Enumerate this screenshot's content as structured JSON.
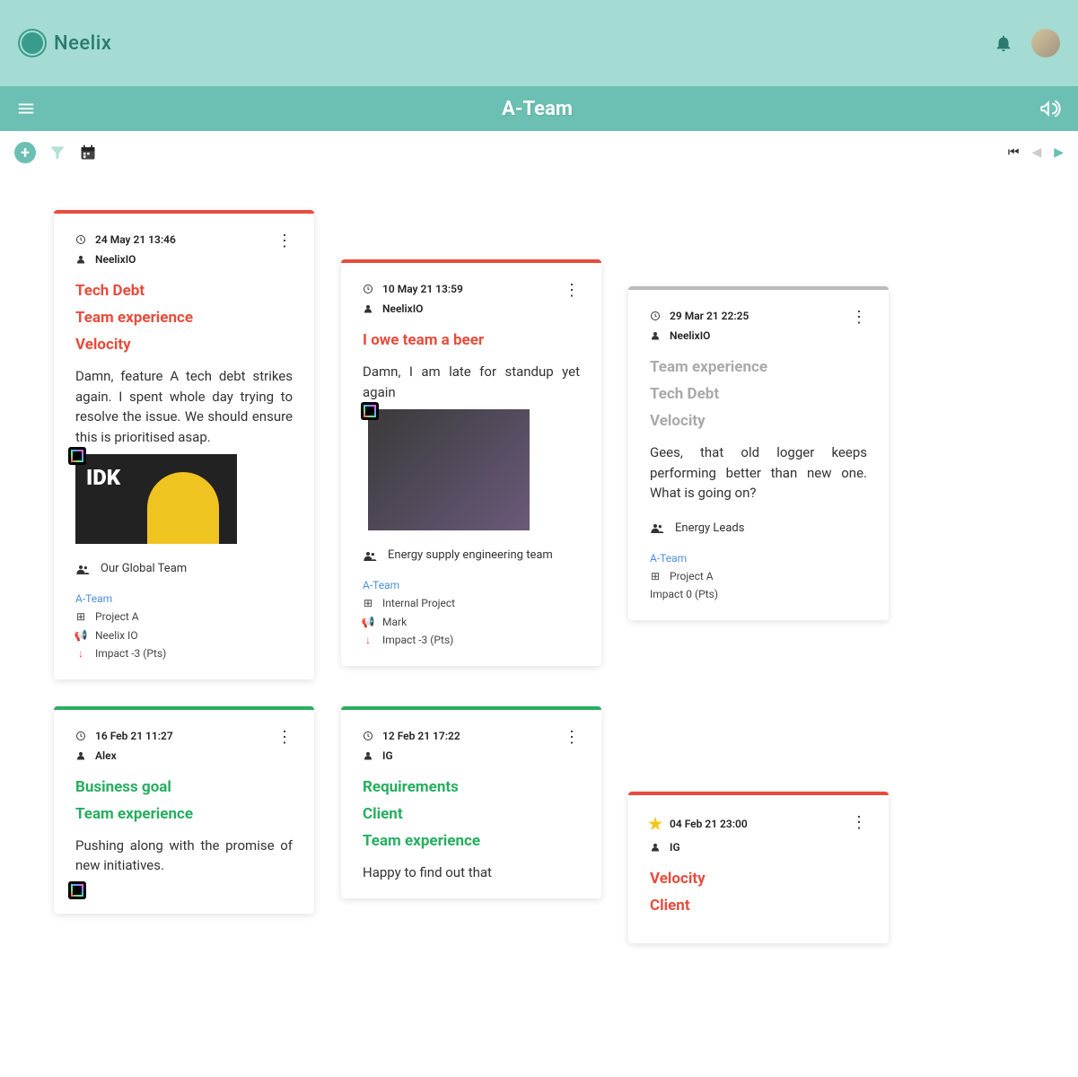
{
  "brand": "Neelix",
  "page_title": "A-Team",
  "cards": [
    {
      "timestamp": "24 May 21 13:46",
      "author": "NeelixIO",
      "tags": [
        "Tech Debt",
        "Team experience",
        "Velocity"
      ],
      "tag_color": "red",
      "border": "red",
      "body": "Damn, feature A tech debt strikes again. I spent whole day trying to resolve the issue. We should ensure this is prioritised asap.",
      "image_text": "IDK",
      "team": "Our Global Team",
      "footer_link": "A-Team",
      "project": "Project A",
      "speaker": "Neelix IO",
      "impact": "Impact  -3   (Pts)"
    },
    {
      "timestamp": "10 May 21 13:59",
      "author": "NeelixIO",
      "tags": [
        "I owe team a beer"
      ],
      "tag_color": "red",
      "border": "red",
      "body": "Damn, I am late for standup yet again",
      "team": "Energy supply engineering team",
      "footer_link": "A-Team",
      "project": "Internal Project",
      "speaker": "Mark",
      "impact": "Impact  -3   (Pts)"
    },
    {
      "timestamp": "29 Mar 21 22:25",
      "author": "NeelixIO",
      "tags": [
        "Team experience",
        "Tech Debt",
        "Velocity"
      ],
      "tag_color": "grey",
      "border": "grey",
      "body": "Gees, that old logger keeps performing better than new one. What is going on?",
      "team": "Energy Leads",
      "footer_link": "A-Team",
      "project": "Project A",
      "impact": "Impact   0   (Pts)"
    },
    {
      "timestamp": "16 Feb 21 11:27",
      "author": "Alex",
      "tags": [
        "Business goal",
        "Team experience"
      ],
      "tag_color": "green",
      "border": "green",
      "body": "Pushing along with the promise of  new initiatives."
    },
    {
      "timestamp": "12 Feb 21 17:22",
      "author": "IG",
      "tags": [
        "Requirements",
        "Client",
        "Team experience"
      ],
      "tag_color": "green",
      "border": "green",
      "body": "Happy to find out that"
    },
    {
      "timestamp": "04 Feb 21 23:00",
      "author": "IG",
      "starred": true,
      "tags": [
        "Velocity",
        "Client"
      ],
      "tag_color": "red",
      "border": "red"
    }
  ]
}
